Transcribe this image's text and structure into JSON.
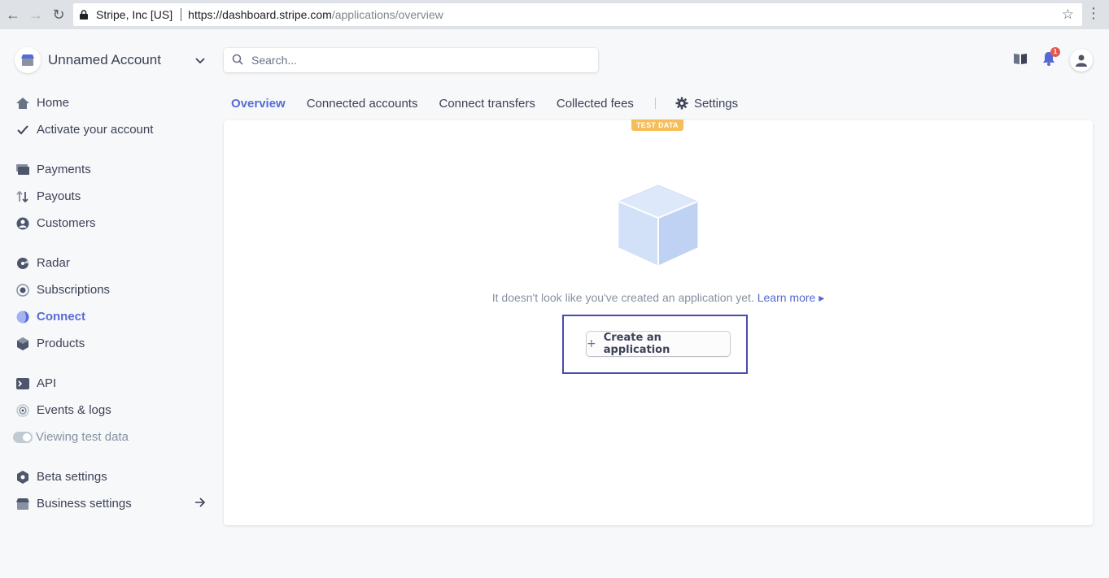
{
  "browser": {
    "site_name": "Stripe, Inc [US]",
    "url_host": "https://dashboard.stripe.com",
    "url_path": "/applications/overview"
  },
  "account": {
    "name": "Unnamed Account"
  },
  "search": {
    "placeholder": "Search..."
  },
  "notifications": {
    "count": "1"
  },
  "sidebar": {
    "home": "Home",
    "activate": "Activate your account",
    "payments": "Payments",
    "payouts": "Payouts",
    "customers": "Customers",
    "radar": "Radar",
    "subscriptions": "Subscriptions",
    "connect": "Connect",
    "products": "Products",
    "api": "API",
    "events": "Events & logs",
    "test_data": "Viewing test data",
    "beta": "Beta settings",
    "business": "Business settings"
  },
  "tabs": {
    "overview": "Overview",
    "connected_accounts": "Connected accounts",
    "connect_transfers": "Connect transfers",
    "collected_fees": "Collected fees",
    "settings": "Settings"
  },
  "main": {
    "test_badge": "TEST DATA",
    "empty_message": "It doesn't look like you've created an application yet.",
    "learn_more": "Learn more ▸",
    "create_button": "Create an application"
  },
  "colors": {
    "accent": "#556cd6",
    "badge": "#f5be58",
    "highlight": "#4a4ab0"
  }
}
